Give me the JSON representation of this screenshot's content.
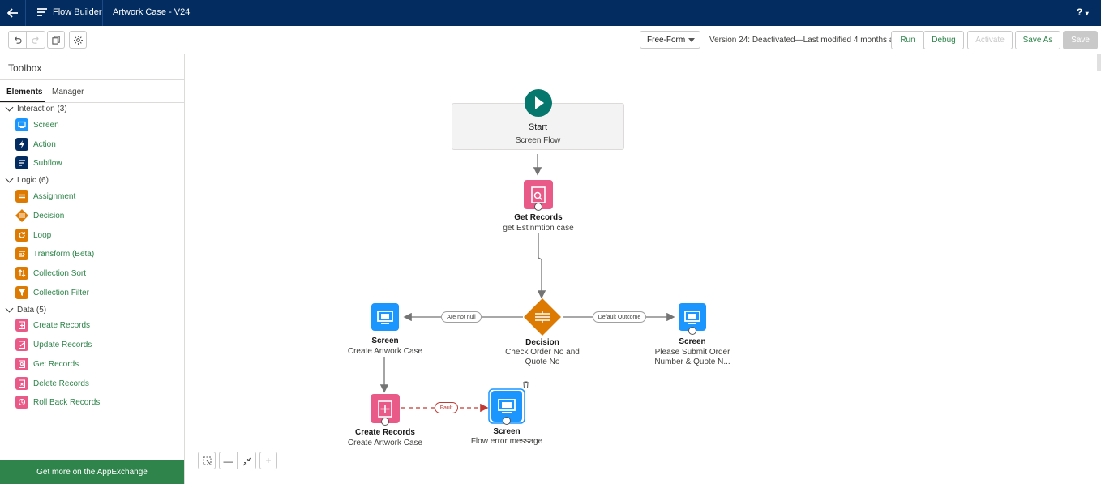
{
  "topbar": {
    "app_name": "Flow Builder",
    "flow_name": "Artwork Case - V24",
    "help": "?"
  },
  "toolbar": {
    "mode": "Free-Form",
    "version_text": "Version 24: Deactivated—Last modified 4 months ago",
    "run": "Run",
    "debug": "Debug",
    "activate": "Activate",
    "save_as": "Save As",
    "save": "Save"
  },
  "sidebar": {
    "title": "Toolbox",
    "tabs": [
      "Elements",
      "Manager"
    ],
    "categories": [
      {
        "label": "Interaction (3)"
      },
      {
        "label": "Logic (6)"
      },
      {
        "label": "Data (5)"
      }
    ],
    "items": [
      {
        "label": "Screen",
        "color": "#1b96ff"
      },
      {
        "label": "Action",
        "color": "#032d60"
      },
      {
        "label": "Subflow",
        "color": "#032d60"
      },
      {
        "label": "Assignment",
        "color": "#dd7a01"
      },
      {
        "label": "Decision",
        "color": "#dd7a01"
      },
      {
        "label": "Loop",
        "color": "#dd7a01"
      },
      {
        "label": "Transform (Beta)",
        "color": "#dd7a01"
      },
      {
        "label": "Collection Sort",
        "color": "#dd7a01"
      },
      {
        "label": "Collection Filter",
        "color": "#dd7a01"
      },
      {
        "label": "Create Records",
        "color": "#ea5a89"
      },
      {
        "label": "Update Records",
        "color": "#ea5a89"
      },
      {
        "label": "Get Records",
        "color": "#ea5a89"
      },
      {
        "label": "Delete Records",
        "color": "#ea5a89"
      },
      {
        "label": "Roll Back Records",
        "color": "#ea5a89"
      }
    ],
    "appexchange": "Get more on the AppExchange"
  },
  "canvas": {
    "start": {
      "title": "Start",
      "subtitle": "Screen Flow"
    },
    "get_records": {
      "title": "Get Records",
      "subtitle": "get Estinmtion case"
    },
    "decision": {
      "title": "Decision",
      "subtitle_1": "Check Order No and",
      "subtitle_2": "Quote No"
    },
    "screen_left": {
      "title": "Screen",
      "subtitle": "Create Artwork Case"
    },
    "screen_right": {
      "title": "Screen",
      "subtitle_1": "Please Submit Order",
      "subtitle_2": "Number & Quote N..."
    },
    "create_records": {
      "title": "Create Records",
      "subtitle": "Create Artwork Case"
    },
    "screen_error": {
      "title": "Screen",
      "subtitle": "Flow error message"
    },
    "edge_labels": {
      "left": "Are not null",
      "right": "Default Outcome",
      "fault": "Fault"
    }
  }
}
